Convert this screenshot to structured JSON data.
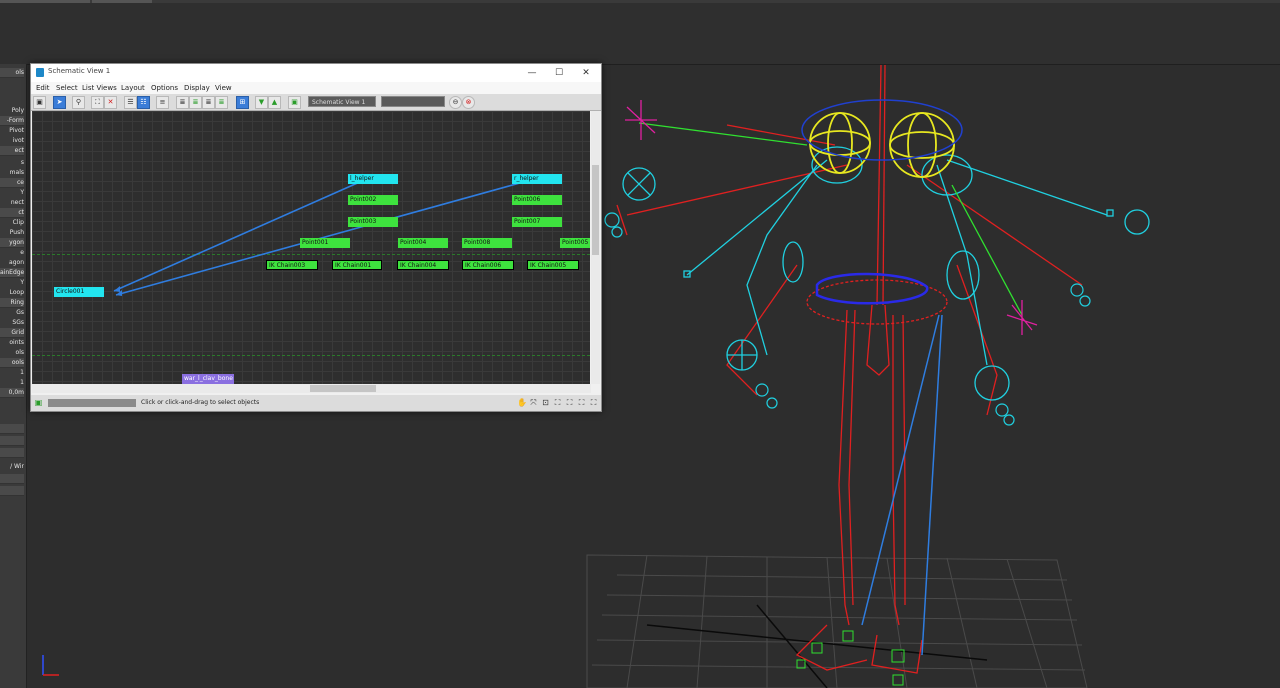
{
  "left_panel": {
    "items": [
      "ols",
      "",
      "Poly",
      "-Form",
      "Pivot",
      "ivot",
      "ect",
      "s",
      "mals",
      "ce",
      "Y",
      "nect",
      "ct",
      "Clip",
      "Push",
      "ygon",
      "e",
      "agon",
      "ainEdge",
      "Y",
      "Loop",
      "Ring",
      "Gs",
      "SGs",
      "Grid",
      "oints",
      "ols",
      "ools",
      "1",
      "1",
      "0,0m",
      "",
      "/ Wir"
    ]
  },
  "schematic_window": {
    "title": "Schematic View 1",
    "controls": {
      "minimize": "—",
      "maximize": "☐",
      "close": "✕"
    },
    "menu": [
      "Edit",
      "Select",
      "List Views",
      "Layout",
      "Options",
      "Display",
      "View"
    ],
    "toolbar": {
      "view_name_field": "Schematic View 1",
      "search_field": ""
    },
    "nodes": [
      {
        "label": "l_helper",
        "style": "cyan"
      },
      {
        "label": "r_helper",
        "style": "cyan"
      },
      {
        "label": "Point002",
        "style": "green"
      },
      {
        "label": "Point006",
        "style": "green"
      },
      {
        "label": "Point003",
        "style": "green"
      },
      {
        "label": "Point007",
        "style": "green"
      },
      {
        "label": "Point001",
        "style": "green"
      },
      {
        "label": "Point004",
        "style": "green"
      },
      {
        "label": "Point008",
        "style": "green"
      },
      {
        "label": "Point005",
        "style": "green"
      },
      {
        "label": "IK Chain003",
        "style": "ik"
      },
      {
        "label": "IK Chain001",
        "style": "ik"
      },
      {
        "label": "IK Chain004",
        "style": "ik"
      },
      {
        "label": "IK Chain006",
        "style": "ik"
      },
      {
        "label": "IK Chain005",
        "style": "ik"
      },
      {
        "label": "Circle001",
        "style": "cyan"
      },
      {
        "label": "war_l_clav_bone",
        "style": "purple"
      }
    ],
    "status_prompt": "Click or click-and-drag to select objects"
  },
  "colors": {
    "node_cyan": "#22e5ef",
    "node_green": "#3ee23e",
    "node_purple": "#8a6fe0",
    "link_blue": "#2f7de0",
    "rig_red": "#e02020",
    "rig_cyan": "#20d0e0",
    "rig_yellow": "#e8e820"
  }
}
